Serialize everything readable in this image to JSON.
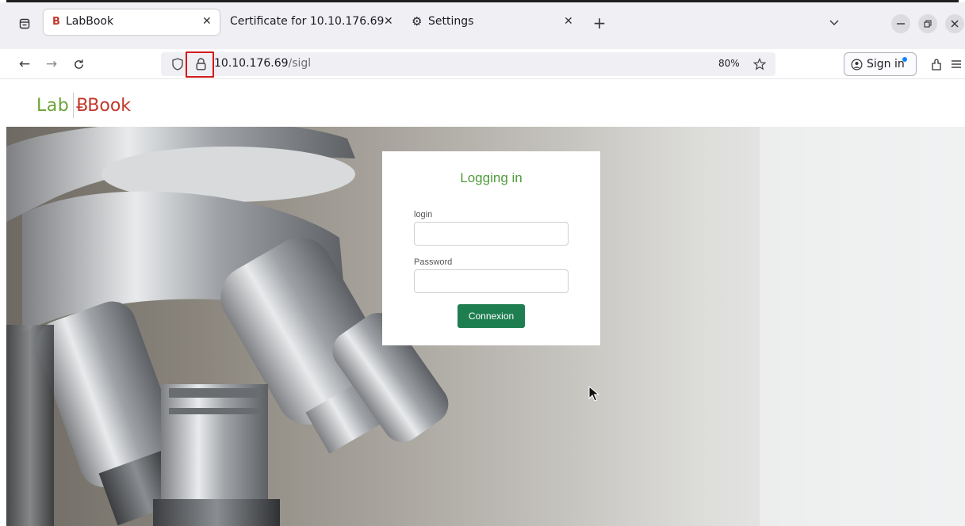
{
  "browser": {
    "tabs": [
      {
        "favicon": "B",
        "label": "LabBook",
        "active": true
      },
      {
        "label": "Certificate for 10.10.176.69",
        "active": false
      },
      {
        "label": "Settings",
        "active": false
      }
    ],
    "new_tab_label": "+",
    "address": {
      "host": "10.10.176.69",
      "path": "/sigl"
    },
    "zoom": "80%",
    "sign_in_label": "Sign in",
    "icons": [
      "tab-list-icon",
      "back-icon",
      "forward-icon",
      "reload-icon",
      "shield-icon",
      "lock-icon",
      "bookmark-star-icon",
      "account-icon",
      "extensions-icon",
      "menu-icon",
      "list-all-tabs-icon",
      "minimize-icon",
      "restore-icon",
      "close-window-icon",
      "gear-icon"
    ],
    "highlight_color": "#d11a1a"
  },
  "app": {
    "brand_left": "Lab",
    "brand_right": "Book",
    "brand_colors": {
      "lab": "#6aa334",
      "book": "#c0392b"
    }
  },
  "login": {
    "title": "Logging in",
    "login_label": "login",
    "login_value": "",
    "password_label": "Password",
    "password_value": "",
    "submit_label": "Connexion",
    "button_color": "#1e7e4f",
    "title_color": "#4f9b3a"
  }
}
